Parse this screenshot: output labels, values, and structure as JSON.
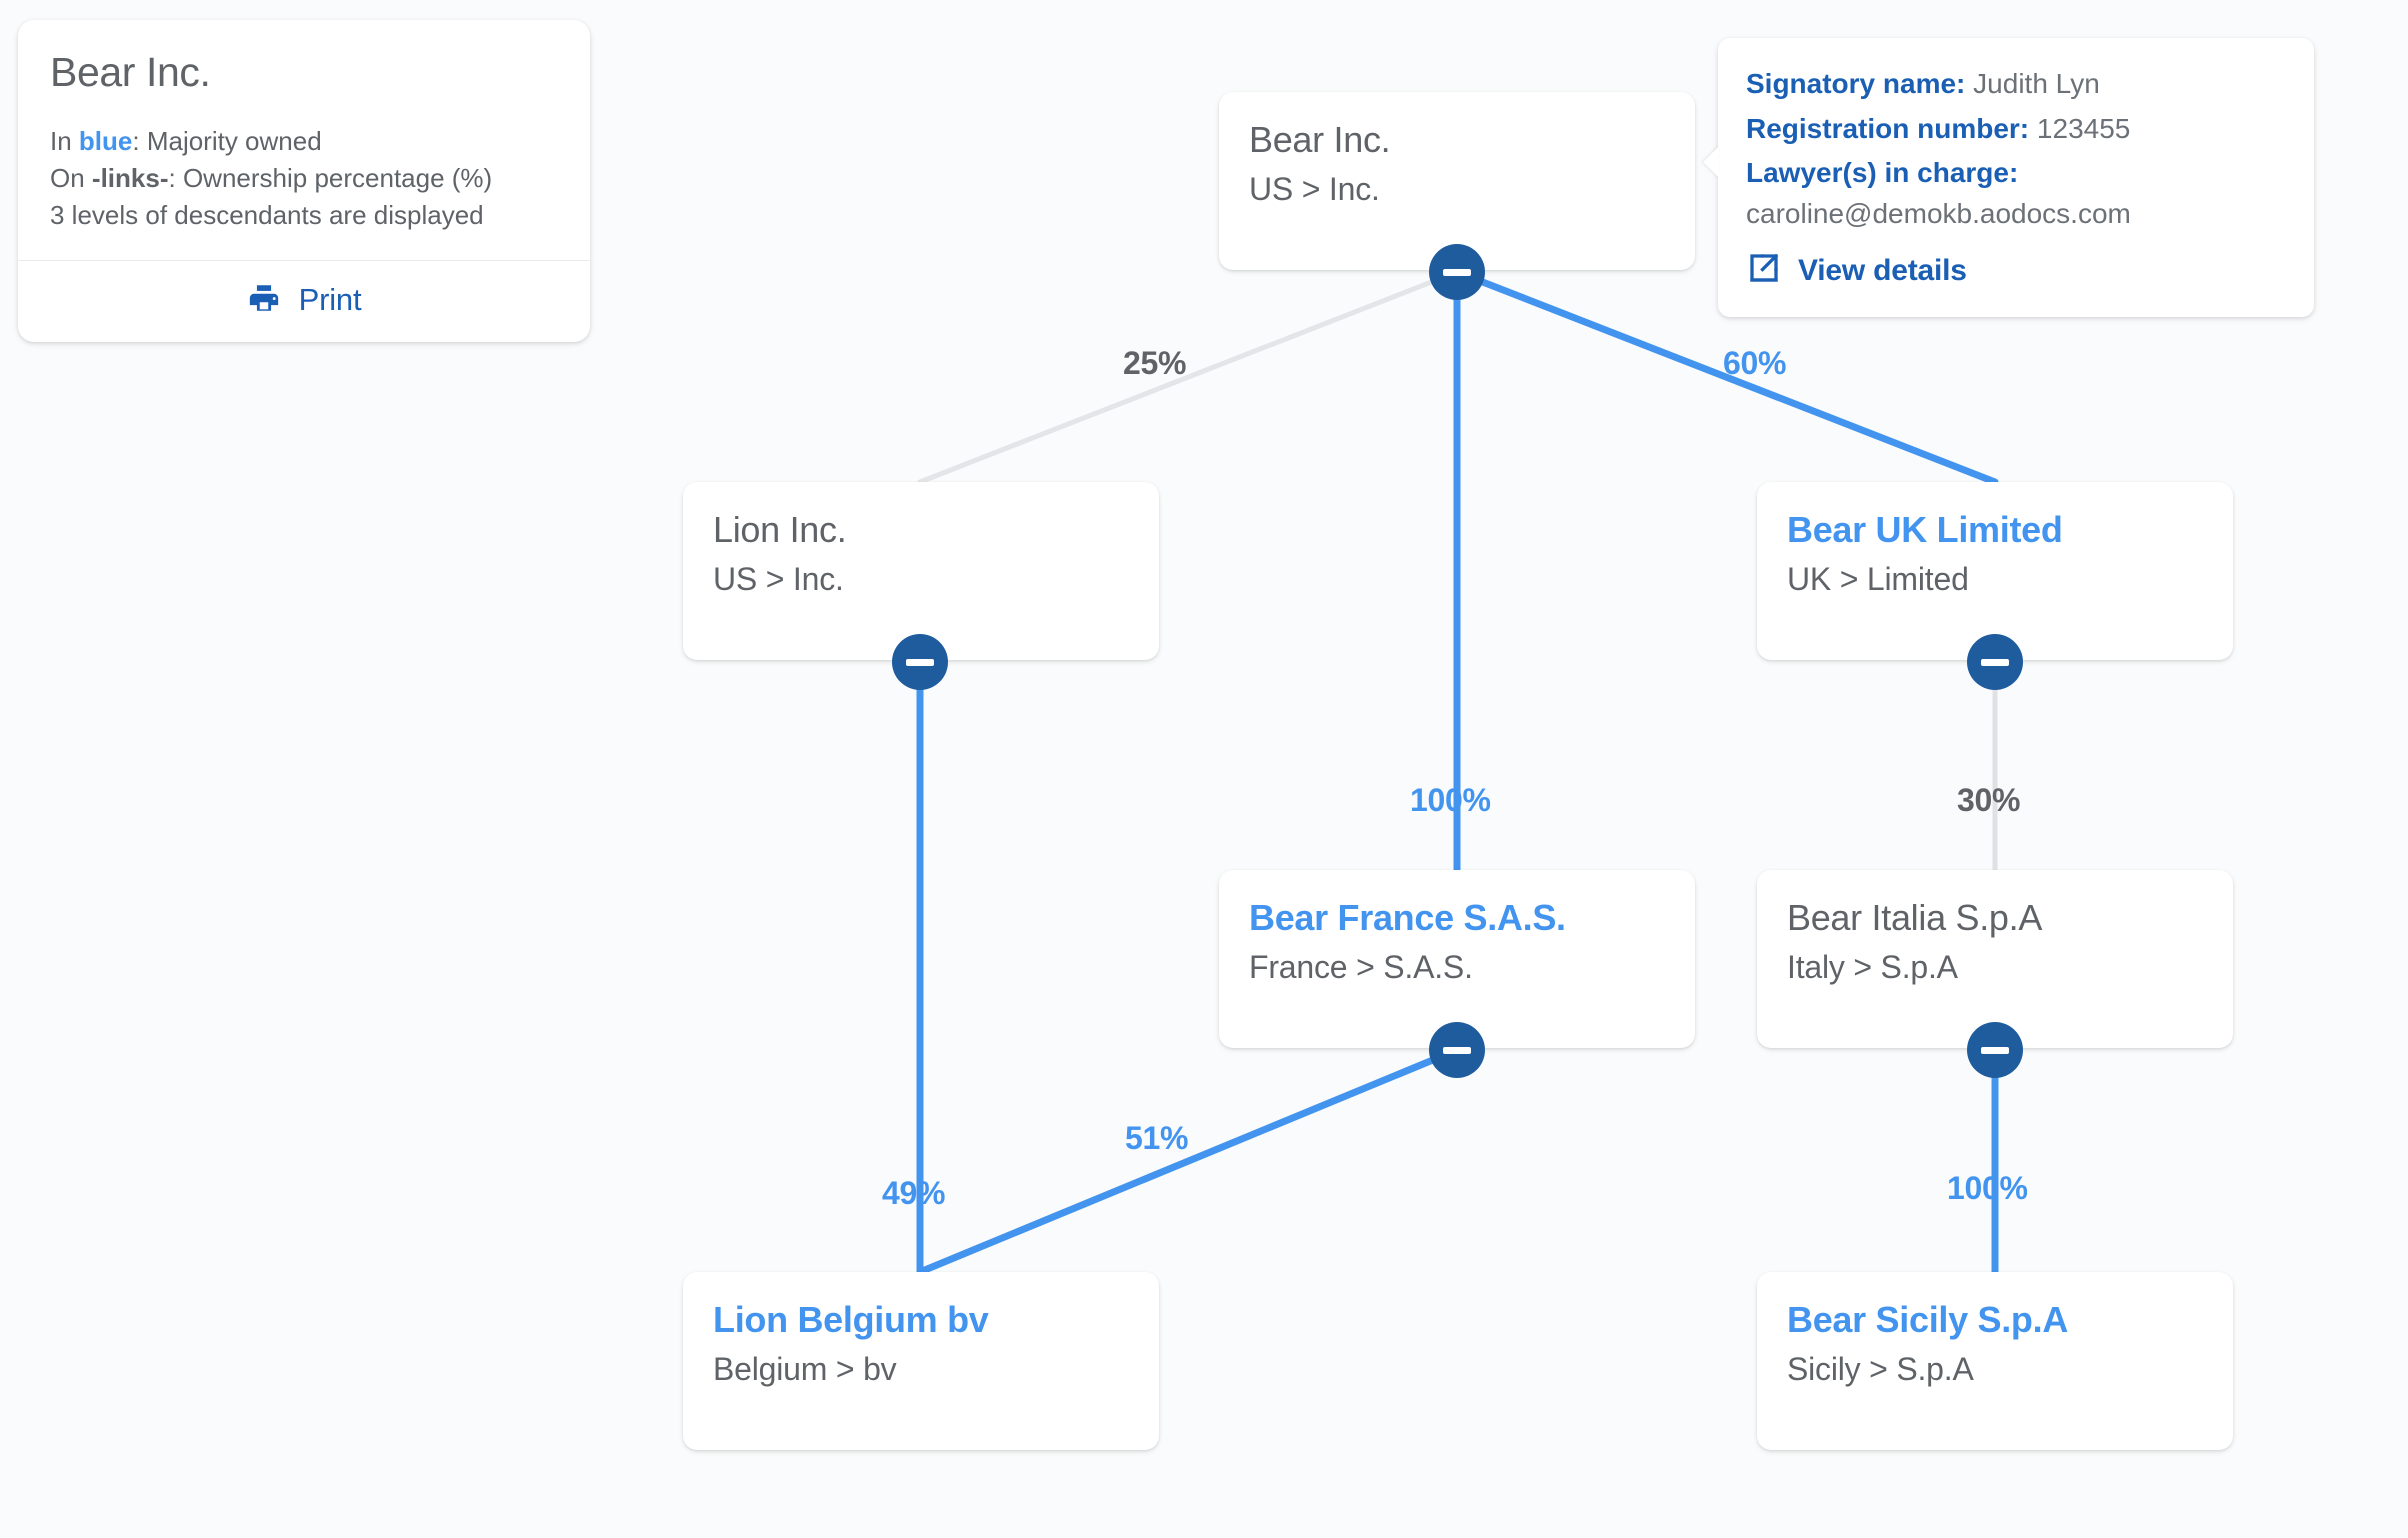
{
  "colors": {
    "background": "#fafbfc",
    "card": "#ffffff",
    "majority_blue": "#4294ef",
    "link_blue": "#4294ef",
    "link_grey": "#e3e5e8",
    "toggle_navy": "#1f5c9e",
    "text_grey": "#5f6368",
    "accent_dark_blue": "#1a5fb4"
  },
  "legend": {
    "title": "Bear Inc.",
    "line1_prefix": "In ",
    "line1_highlight": "blue",
    "line1_suffix": ": Majority owned",
    "line2_prefix": "On ",
    "line2_highlight": "-links-",
    "line2_suffix": ": Ownership percentage (%)",
    "line3": "3 levels of descendants are displayed",
    "print_label": "Print"
  },
  "info_panel": {
    "rows": [
      {
        "key": "Signatory name:",
        "value": "Judith Lyn"
      },
      {
        "key": "Registration number:",
        "value": "123455"
      },
      {
        "key": "Lawyer(s) in charge:",
        "value": "caroline@demokb.aodocs.com"
      }
    ],
    "view_details_label": "View details"
  },
  "chart_data": {
    "type": "diagram",
    "title": "Bear Inc. ownership structure",
    "nodes": [
      {
        "id": "bear-inc",
        "name": "Bear Inc.",
        "subtitle": "US > Inc.",
        "ownership": "root",
        "collapsible": true
      },
      {
        "id": "lion-inc",
        "name": "Lion Inc.",
        "subtitle": "US > Inc.",
        "ownership": "minority",
        "collapsible": true
      },
      {
        "id": "bear-uk",
        "name": "Bear UK Limited",
        "subtitle": "UK > Limited",
        "ownership": "majority",
        "collapsible": true
      },
      {
        "id": "bear-france",
        "name": "Bear France S.A.S.",
        "subtitle": "France > S.A.S.",
        "ownership": "majority",
        "collapsible": true
      },
      {
        "id": "bear-italia",
        "name": "Bear Italia S.p.A",
        "subtitle": "Italy > S.p.A",
        "ownership": "minority",
        "collapsible": true
      },
      {
        "id": "lion-belgium",
        "name": "Lion Belgium bv",
        "subtitle": "Belgium > bv",
        "ownership": "majority",
        "collapsible": false
      },
      {
        "id": "bear-sicily",
        "name": "Bear Sicily S.p.A",
        "subtitle": "Sicily > S.p.A",
        "ownership": "majority",
        "collapsible": false
      }
    ],
    "edges": [
      {
        "from": "bear-inc",
        "to": "lion-inc",
        "percent": "25%",
        "style": "minority"
      },
      {
        "from": "bear-inc",
        "to": "bear-france",
        "percent": "100%",
        "style": "majority"
      },
      {
        "from": "bear-inc",
        "to": "bear-uk",
        "percent": "60%",
        "style": "majority"
      },
      {
        "from": "bear-uk",
        "to": "bear-italia",
        "percent": "30%",
        "style": "minority"
      },
      {
        "from": "lion-inc",
        "to": "lion-belgium",
        "percent": "49%",
        "style": "majority"
      },
      {
        "from": "bear-france",
        "to": "lion-belgium",
        "percent": "51%",
        "style": "majority"
      },
      {
        "from": "bear-italia",
        "to": "bear-sicily",
        "percent": "100%",
        "style": "majority"
      }
    ]
  }
}
